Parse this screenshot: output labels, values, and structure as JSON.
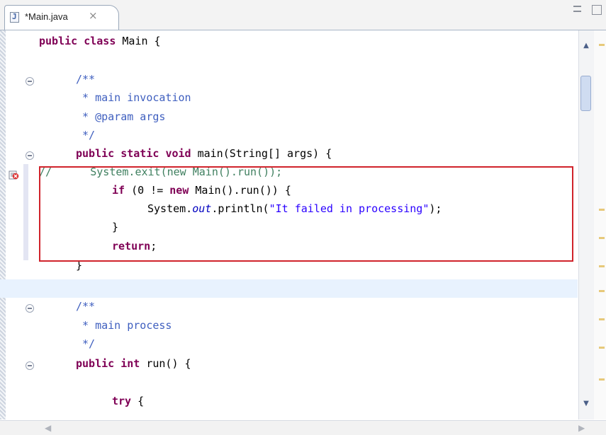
{
  "tab": {
    "title": "*Main.java",
    "file_icon_letter": "J",
    "close_glyph": "×"
  },
  "code": {
    "lines": [
      [
        {
          "t": "public",
          "c": "kw"
        },
        {
          "t": " "
        },
        {
          "t": "class",
          "c": "kw"
        },
        {
          "t": " Main {"
        }
      ],
      [],
      [
        {
          "t": "/**",
          "c": "comment"
        }
      ],
      [
        {
          "t": " * main invocation",
          "c": "comment"
        }
      ],
      [
        {
          "t": " * @param args",
          "c": "comment"
        }
      ],
      [
        {
          "t": " */",
          "c": "comment"
        }
      ],
      [
        {
          "t": "public",
          "c": "kw"
        },
        {
          "t": " "
        },
        {
          "t": "static",
          "c": "kw"
        },
        {
          "t": " "
        },
        {
          "t": "void",
          "c": "kw"
        },
        {
          "t": " main(String[] args) {"
        }
      ],
      [
        {
          "t": "//      System.exit(new Main().run());",
          "c": "line-comment"
        }
      ],
      [
        {
          "t": "if",
          "c": "kw"
        },
        {
          "t": " (0 != "
        },
        {
          "t": "new",
          "c": "kw"
        },
        {
          "t": " Main().run()) {"
        }
      ],
      [
        {
          "t": "System."
        },
        {
          "t": "out",
          "c": "fld"
        },
        {
          "t": ".println("
        },
        {
          "t": "\"It failed in processing\"",
          "c": "str"
        },
        {
          "t": ");"
        }
      ],
      [
        {
          "t": "}"
        }
      ],
      [
        {
          "t": "return",
          "c": "kw"
        },
        {
          "t": ";"
        }
      ],
      [
        {
          "t": "}"
        }
      ],
      [],
      [
        {
          "t": "/**",
          "c": "comment"
        }
      ],
      [
        {
          "t": " * main process",
          "c": "comment"
        }
      ],
      [
        {
          "t": " */",
          "c": "comment"
        }
      ],
      [
        {
          "t": "public",
          "c": "kw"
        },
        {
          "t": " "
        },
        {
          "t": "int",
          "c": "kw"
        },
        {
          "t": " run() {"
        }
      ],
      [],
      [
        {
          "t": "try",
          "c": "kw"
        },
        {
          "t": " {"
        }
      ]
    ]
  },
  "icons": {
    "scroll_up": "▲",
    "scroll_down": "▼",
    "scroll_left": "◀",
    "scroll_right": "▶"
  },
  "colors": {
    "keyword": "#7f0055",
    "comment": "#3f5fbf",
    "line_comment": "#3f7f5f",
    "string": "#2a00ff",
    "highlight_box": "#d0232b",
    "current_line": "#e8f2fe"
  }
}
